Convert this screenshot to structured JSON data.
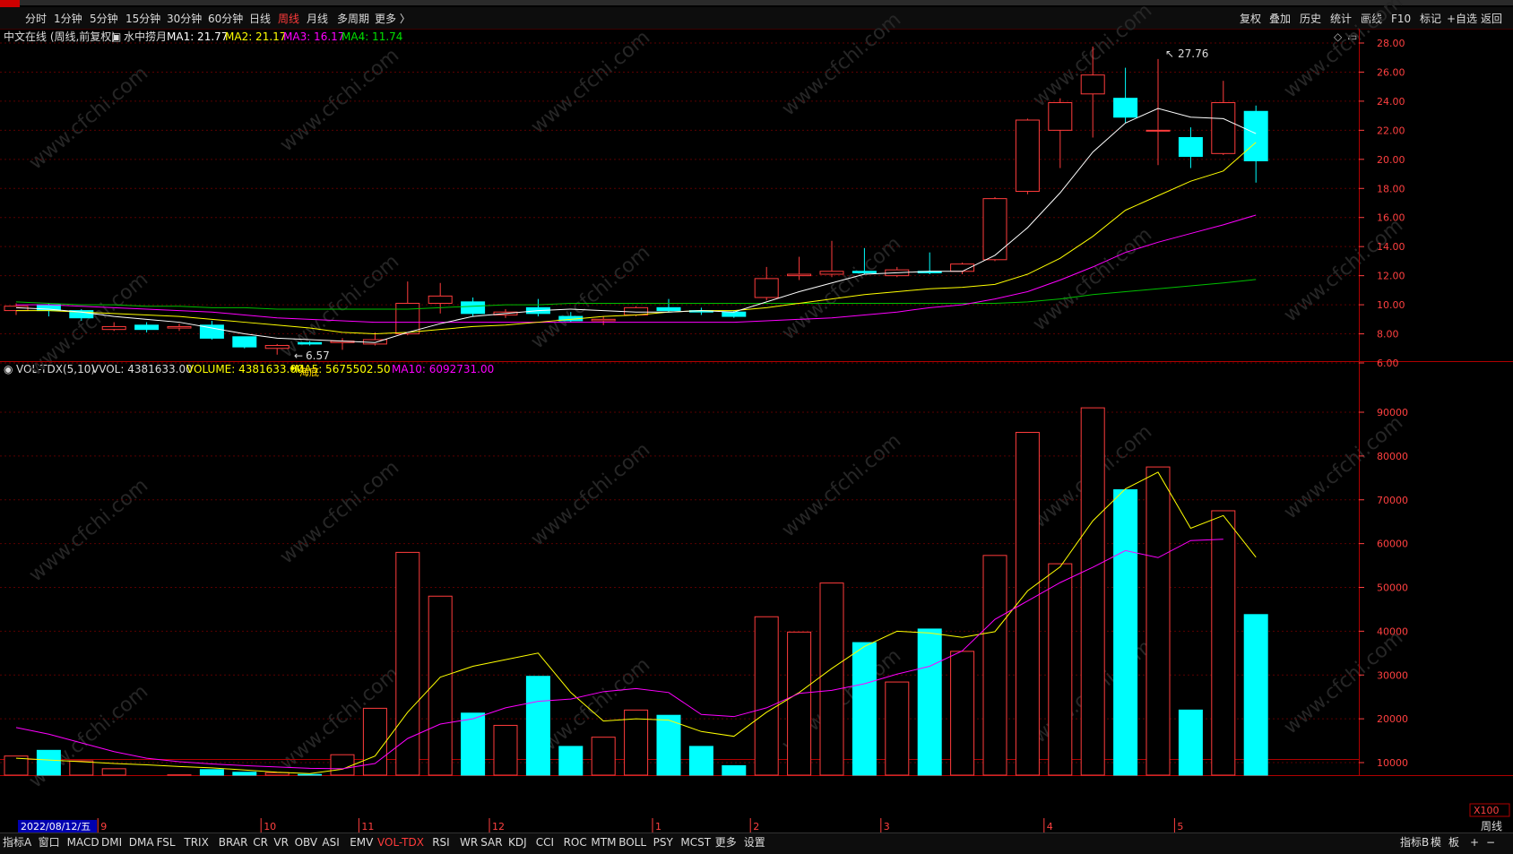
{
  "toolbar": {
    "periods": [
      "分时",
      "1分钟",
      "5分钟",
      "15分钟",
      "30分钟",
      "60分钟",
      "日线",
      "周线",
      "月线",
      "多周期",
      "更多 〉"
    ],
    "active_period": "周线",
    "right_buttons": [
      "复权",
      "叠加",
      "历史",
      "统计",
      "画线",
      "F10",
      "标记",
      "+自选",
      "返回"
    ]
  },
  "price_panel": {
    "stock_label": "中文在线 (周线,前复权)",
    "indicator_name": "水中捞月",
    "ma1_label": "MA1: 21.77",
    "ma2_label": "MA2: 21.17",
    "ma3_label": "MA3: 16.17",
    "ma4_label": "MA4: 11.74",
    "high_marker": "27.76",
    "low_marker": "6.57",
    "signal_text": "海底",
    "y_ticks": [
      "28.00",
      "26.00",
      "24.00",
      "22.00",
      "20.00",
      "18.00",
      "16.00",
      "14.00",
      "12.00",
      "10.00",
      "8.00",
      "6.00"
    ]
  },
  "volume_panel": {
    "indicator_label": "VOL-TDX(5,10)",
    "vvol_label": "VVOL: 4381633.00",
    "volume_label": "VOLUME: 4381633.00",
    "ma5_label": "MA5: 5675502.50",
    "ma10_label": "MA10: 6092731.00",
    "y_ticks": [
      "90000",
      "80000",
      "70000",
      "60000",
      "50000",
      "40000",
      "30000",
      "20000",
      "10000"
    ],
    "unit_label": "X100"
  },
  "date_axis": {
    "current_date": "2022/08/12/五",
    "month_labels": [
      "9",
      "10",
      "11",
      "12",
      "1",
      "2",
      "3",
      "4",
      "5"
    ],
    "period_label": "周线"
  },
  "bottom_tabs": {
    "items": [
      "指标A",
      "窗口",
      "MACD",
      "DMI",
      "DMA",
      "FSL",
      "TRIX",
      "BRAR",
      "CR",
      "VR",
      "OBV",
      "ASI",
      "EMV",
      "VOL-TDX",
      "RSI",
      "WR",
      "SAR",
      "KDJ",
      "CCI",
      "ROC",
      "MTM",
      "BOLL",
      "PSY",
      "MCST",
      "更多",
      "设置"
    ],
    "active": "VOL-TDX",
    "right_items": [
      "指标B",
      "模",
      "板",
      "+",
      "−"
    ]
  },
  "watermark": "www.cfchi.com",
  "colors": {
    "up": "#ff3c3c",
    "down": "#00ffff",
    "ma1": "#ffffff",
    "ma2": "#ffff00",
    "ma3": "#ff00ff",
    "ma4": "#00c000",
    "axis": "#ff4040",
    "background": "#000000"
  },
  "chart_data": [
    {
      "type": "candlestick",
      "title": "中文在线 (周线,前复权)",
      "ylim": [
        5,
        29
      ],
      "candles": [
        {
          "o": 9.6,
          "h": 10.1,
          "l": 9.3,
          "c": 9.9
        },
        {
          "o": 10.0,
          "h": 10.1,
          "l": 9.2,
          "c": 9.6
        },
        {
          "o": 9.6,
          "h": 9.7,
          "l": 8.9,
          "c": 9.1
        },
        {
          "o": 8.3,
          "h": 8.8,
          "l": 8.2,
          "c": 8.5
        },
        {
          "o": 8.6,
          "h": 8.8,
          "l": 8.1,
          "c": 8.3
        },
        {
          "o": 8.4,
          "h": 8.7,
          "l": 8.2,
          "c": 8.5
        },
        {
          "o": 8.6,
          "h": 8.9,
          "l": 7.6,
          "c": 7.7
        },
        {
          "o": 7.8,
          "h": 7.8,
          "l": 7.0,
          "c": 7.1
        },
        {
          "o": 7.0,
          "h": 7.3,
          "l": 6.57,
          "c": 7.2
        },
        {
          "o": 7.4,
          "h": 7.5,
          "l": 7.2,
          "c": 7.3
        },
        {
          "o": 7.4,
          "h": 7.7,
          "l": 6.9,
          "c": 7.5
        },
        {
          "o": 7.3,
          "h": 8.1,
          "l": 7.2,
          "c": 7.6
        },
        {
          "o": 8.0,
          "h": 11.6,
          "l": 7.9,
          "c": 10.1
        },
        {
          "o": 10.1,
          "h": 11.5,
          "l": 9.4,
          "c": 10.6
        },
        {
          "o": 10.2,
          "h": 10.5,
          "l": 9.2,
          "c": 9.4
        },
        {
          "o": 9.3,
          "h": 9.7,
          "l": 9.1,
          "c": 9.5
        },
        {
          "o": 9.8,
          "h": 10.4,
          "l": 9.2,
          "c": 9.4
        },
        {
          "o": 9.2,
          "h": 9.5,
          "l": 8.8,
          "c": 8.9
        },
        {
          "o": 8.9,
          "h": 9.2,
          "l": 8.6,
          "c": 9.0
        },
        {
          "o": 9.3,
          "h": 9.9,
          "l": 9.2,
          "c": 9.8
        },
        {
          "o": 9.8,
          "h": 10.4,
          "l": 9.5,
          "c": 9.6
        },
        {
          "o": 9.6,
          "h": 9.8,
          "l": 9.3,
          "c": 9.5
        },
        {
          "o": 9.5,
          "h": 9.6,
          "l": 9.1,
          "c": 9.2
        },
        {
          "o": 10.5,
          "h": 12.6,
          "l": 10.3,
          "c": 11.8
        },
        {
          "o": 12.0,
          "h": 13.3,
          "l": 11.7,
          "c": 12.1
        },
        {
          "o": 12.1,
          "h": 14.4,
          "l": 11.9,
          "c": 12.3
        },
        {
          "o": 12.3,
          "h": 13.9,
          "l": 12.1,
          "c": 12.2
        },
        {
          "o": 12.0,
          "h": 12.6,
          "l": 11.9,
          "c": 12.4
        },
        {
          "o": 12.3,
          "h": 13.6,
          "l": 12.1,
          "c": 12.2
        },
        {
          "o": 12.3,
          "h": 12.9,
          "l": 12.1,
          "c": 12.8
        },
        {
          "o": 13.1,
          "h": 17.4,
          "l": 13.0,
          "c": 17.3
        },
        {
          "o": 17.8,
          "h": 22.8,
          "l": 17.6,
          "c": 22.7
        },
        {
          "o": 22.0,
          "h": 24.2,
          "l": 19.4,
          "c": 23.9
        },
        {
          "o": 24.5,
          "h": 27.76,
          "l": 21.5,
          "c": 25.8
        },
        {
          "o": 24.2,
          "h": 26.3,
          "l": 22.5,
          "c": 22.9
        },
        {
          "o": 22.0,
          "h": 26.9,
          "l": 19.6,
          "c": 22.0
        },
        {
          "o": 21.5,
          "h": 22.2,
          "l": 19.4,
          "c": 20.2
        },
        {
          "o": 20.4,
          "h": 25.4,
          "l": 20.3,
          "c": 23.9
        },
        {
          "o": 23.3,
          "h": 23.7,
          "l": 18.4,
          "c": 19.9
        }
      ],
      "ma1": [
        9.8,
        9.7,
        9.5,
        9.2,
        9.0,
        8.8,
        8.4,
        8.0,
        7.7,
        7.6,
        7.5,
        7.4,
        8.1,
        8.7,
        9.2,
        9.4,
        9.6,
        9.7,
        9.6,
        9.5,
        9.5,
        9.6,
        9.5,
        10.2,
        10.9,
        11.5,
        12.1,
        12.2,
        12.3,
        12.3,
        13.4,
        15.3,
        17.7,
        20.5,
        22.5,
        23.5,
        22.9,
        22.8,
        21.77
      ],
      "ma2": [
        9.6,
        9.6,
        9.5,
        9.4,
        9.3,
        9.2,
        9.0,
        8.8,
        8.6,
        8.4,
        8.1,
        8.0,
        8.1,
        8.3,
        8.5,
        8.6,
        8.8,
        9.0,
        9.2,
        9.3,
        9.5,
        9.6,
        9.6,
        9.8,
        10.1,
        10.4,
        10.7,
        10.9,
        11.1,
        11.2,
        11.4,
        12.1,
        13.2,
        14.7,
        16.5,
        17.5,
        18.5,
        19.2,
        21.17
      ],
      "ma3": [
        10.0,
        10.0,
        9.9,
        9.8,
        9.7,
        9.6,
        9.5,
        9.3,
        9.1,
        9.0,
        8.9,
        8.8,
        8.8,
        8.8,
        8.8,
        8.8,
        8.8,
        8.8,
        8.8,
        8.8,
        8.8,
        8.8,
        8.8,
        8.9,
        9.0,
        9.1,
        9.3,
        9.5,
        9.8,
        10.0,
        10.4,
        10.9,
        11.7,
        12.6,
        13.6,
        14.3,
        14.9,
        15.5,
        16.17
      ],
      "ma4": [
        10.2,
        10.1,
        10.0,
        10.0,
        9.9,
        9.9,
        9.8,
        9.8,
        9.7,
        9.7,
        9.7,
        9.7,
        9.7,
        9.8,
        9.9,
        10.0,
        10.0,
        10.1,
        10.1,
        10.1,
        10.1,
        10.1,
        10.1,
        10.1,
        10.1,
        10.1,
        10.1,
        10.1,
        10.1,
        10.1,
        10.1,
        10.2,
        10.4,
        10.7,
        10.9,
        11.1,
        11.3,
        11.5,
        11.74
      ]
    },
    {
      "type": "bar",
      "title": "VOL-TDX(5,10)",
      "ylim": [
        0,
        95000
      ],
      "unit": "X100",
      "volumes": [
        11500,
        12800,
        10400,
        8600,
        6600,
        7200,
        8400,
        7800,
        7700,
        7300,
        11800,
        22400,
        58000,
        48000,
        21300,
        18500,
        29700,
        13700,
        15800,
        22000,
        20800,
        13700,
        9300,
        43300,
        39800,
        51000,
        37400,
        28400,
        40500,
        35400,
        57300,
        85400,
        55400,
        91000,
        72300,
        77500,
        22000,
        67500,
        43800
      ],
      "up": [
        true,
        false,
        true,
        true,
        false,
        true,
        false,
        false,
        true,
        false,
        true,
        true,
        true,
        true,
        false,
        true,
        false,
        false,
        true,
        true,
        false,
        false,
        false,
        true,
        true,
        true,
        false,
        true,
        false,
        true,
        true,
        true,
        true,
        true,
        false,
        true,
        false,
        true,
        false
      ],
      "ma5": [
        11000,
        10600,
        10200,
        9800,
        9500,
        9100,
        8800,
        8300,
        7800,
        7500,
        8500,
        11500,
        21500,
        29500,
        32000,
        33500,
        35000,
        26000,
        19500,
        20000,
        19700,
        17100,
        16000,
        21500,
        26000,
        31500,
        36500,
        40000,
        39600,
        38600,
        39900,
        49200,
        54700,
        65200,
        72500,
        76300,
        63500,
        66400,
        56900
      ],
      "ma10": [
        18000,
        16500,
        14500,
        12500,
        11000,
        10200,
        9700,
        9300,
        9000,
        8700,
        8600,
        9800,
        15500,
        18800,
        20000,
        22500,
        24000,
        24500,
        26200,
        26900,
        26000,
        21000,
        20500,
        22500,
        25800,
        26500,
        28000,
        30200,
        32000,
        35500,
        42700,
        46900,
        51100,
        54600,
        58400,
        56800,
        60700,
        61000
      ]
    }
  ]
}
